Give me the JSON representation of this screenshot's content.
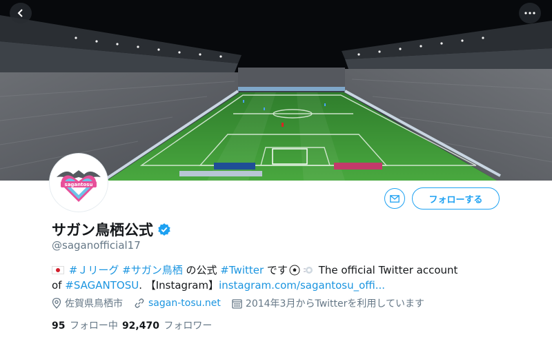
{
  "banner": {
    "back_icon": "chevron-left-icon",
    "more_icon": "ellipsis-icon"
  },
  "avatar": {
    "logo_text": "sagantosu"
  },
  "actions": {
    "message_icon": "envelope-icon",
    "follow_label": "フォローする"
  },
  "profile": {
    "name": "サガン鳥栖公式",
    "handle": "@saganofficial17",
    "verified_icon": "verified-badge-icon"
  },
  "bio": {
    "tag1": "#Ｊリーグ",
    "tag2": "#サガン鳥栖",
    "text1": "の公式",
    "tag3": "#Twitter",
    "text2": "です",
    "text3": "The official Twitter account",
    "text4": "of",
    "tag4": "#SAGANTOSU",
    "text5": ". 【Instagram】",
    "instagram_link": "instagram.com/sagantosu_offi..."
  },
  "meta": {
    "location": "佐賀県鳥栖市",
    "website": "sagan-tosu.net",
    "joined": "2014年3月からTwitterを利用しています"
  },
  "stats": {
    "following_count": "95",
    "following_label": "フォロー中",
    "followers_count": "92,470",
    "followers_label": "フォロワー"
  },
  "colors": {
    "accent": "#1da1f2",
    "link": "#1b95e0",
    "secondary_text": "#657786",
    "pitch_green": "#3f9a3a"
  }
}
